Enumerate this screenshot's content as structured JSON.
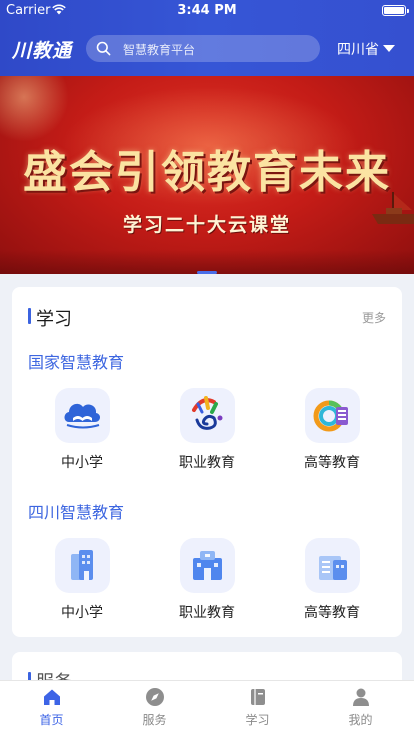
{
  "status_bar": {
    "carrier": "Carrier",
    "time": "3:44 PM"
  },
  "header": {
    "logo": "川教通",
    "search_placeholder": "智慧教育平台",
    "region": "四川省"
  },
  "banner": {
    "title": "盛会引领教育未来",
    "subtitle": "学习二十大云课堂"
  },
  "learning": {
    "title": "学习",
    "more": "更多",
    "groups": [
      {
        "title": "国家智慧教育",
        "items": [
          {
            "label": "中小学",
            "icon": "cloud-book-icon"
          },
          {
            "label": "职业教育",
            "icon": "palette-logo-icon"
          },
          {
            "label": "高等教育",
            "icon": "higher-edu-logo-icon"
          }
        ]
      },
      {
        "title": "四川智慧教育",
        "items": [
          {
            "label": "中小学",
            "icon": "school-building-icon"
          },
          {
            "label": "职业教育",
            "icon": "vocational-building-icon"
          },
          {
            "label": "高等教育",
            "icon": "university-building-icon"
          }
        ]
      }
    ]
  },
  "service_section": {
    "title": "服务"
  },
  "tabbar": {
    "tabs": [
      {
        "label": "首页",
        "icon": "home-icon",
        "active": true
      },
      {
        "label": "服务",
        "icon": "compass-icon",
        "active": false
      },
      {
        "label": "学习",
        "icon": "book-icon",
        "active": false
      },
      {
        "label": "我的",
        "icon": "person-icon",
        "active": false
      }
    ]
  },
  "colors": {
    "header_blue": "#3350d2",
    "accent_blue": "#3d66e0",
    "banner_red": "#c41c17",
    "banner_gold": "#fbe3a2"
  }
}
